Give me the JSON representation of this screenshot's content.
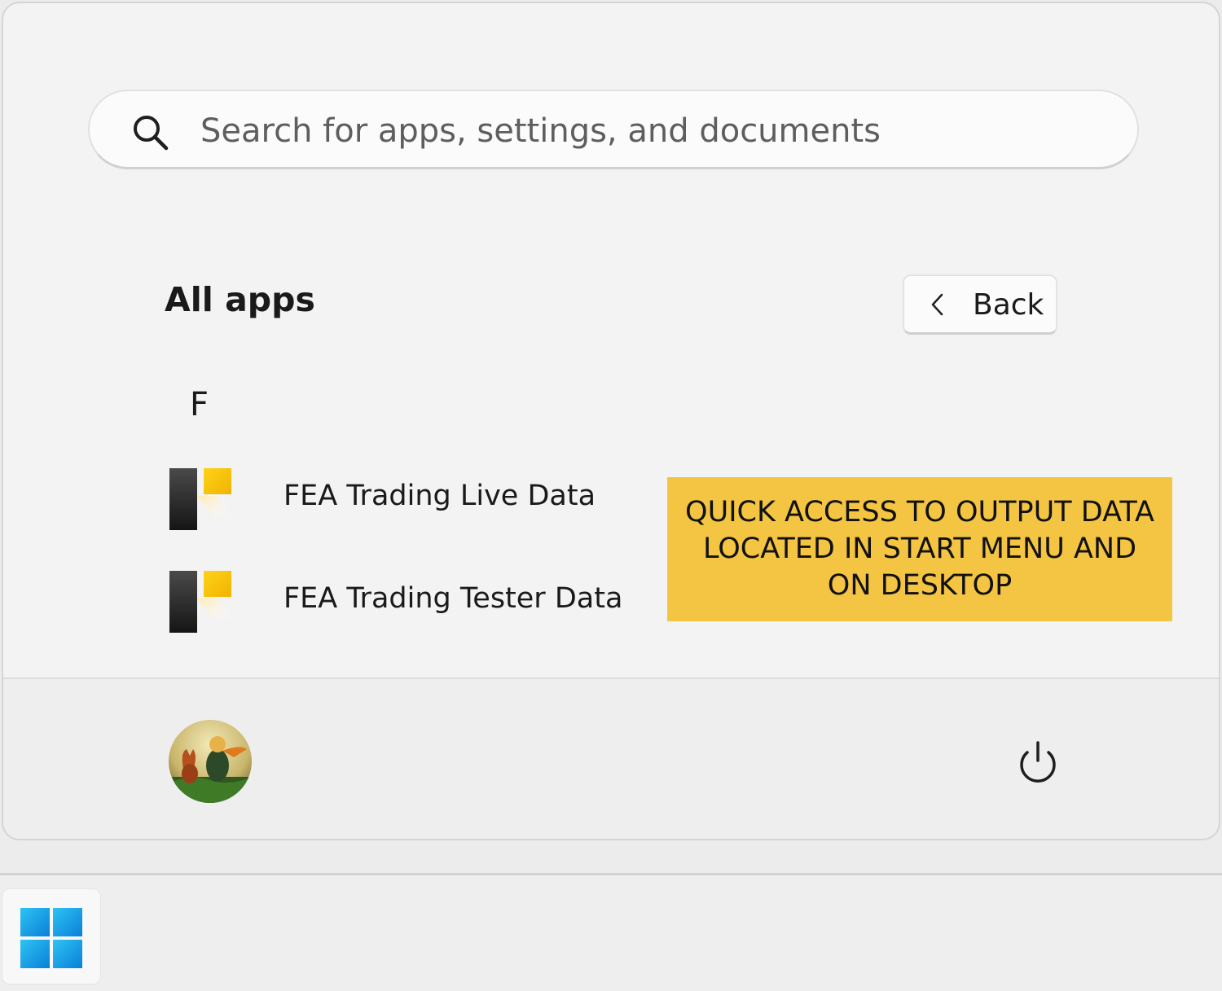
{
  "search": {
    "placeholder": "Search for apps, settings, and documents",
    "icon": "search-icon"
  },
  "all_apps": {
    "title": "All apps",
    "back_label": "Back",
    "back_icon": "chevron-left-icon"
  },
  "app_list": {
    "letter": "F",
    "items": [
      {
        "label": "FEA Trading Live Data",
        "icon": "fea-app-icon"
      },
      {
        "label": "FEA Trading Tester Data",
        "icon": "fea-app-icon"
      }
    ]
  },
  "callout": {
    "text": "QUICK ACCESS TO OUTPUT DATA LOCATED IN START MENU AND ON DESKTOP",
    "color": "#f4c443"
  },
  "footer": {
    "avatar_icon": "user-avatar",
    "power_icon": "power-icon"
  },
  "taskbar": {
    "start_icon": "windows-logo-icon",
    "accent": "#1a9fe0"
  }
}
